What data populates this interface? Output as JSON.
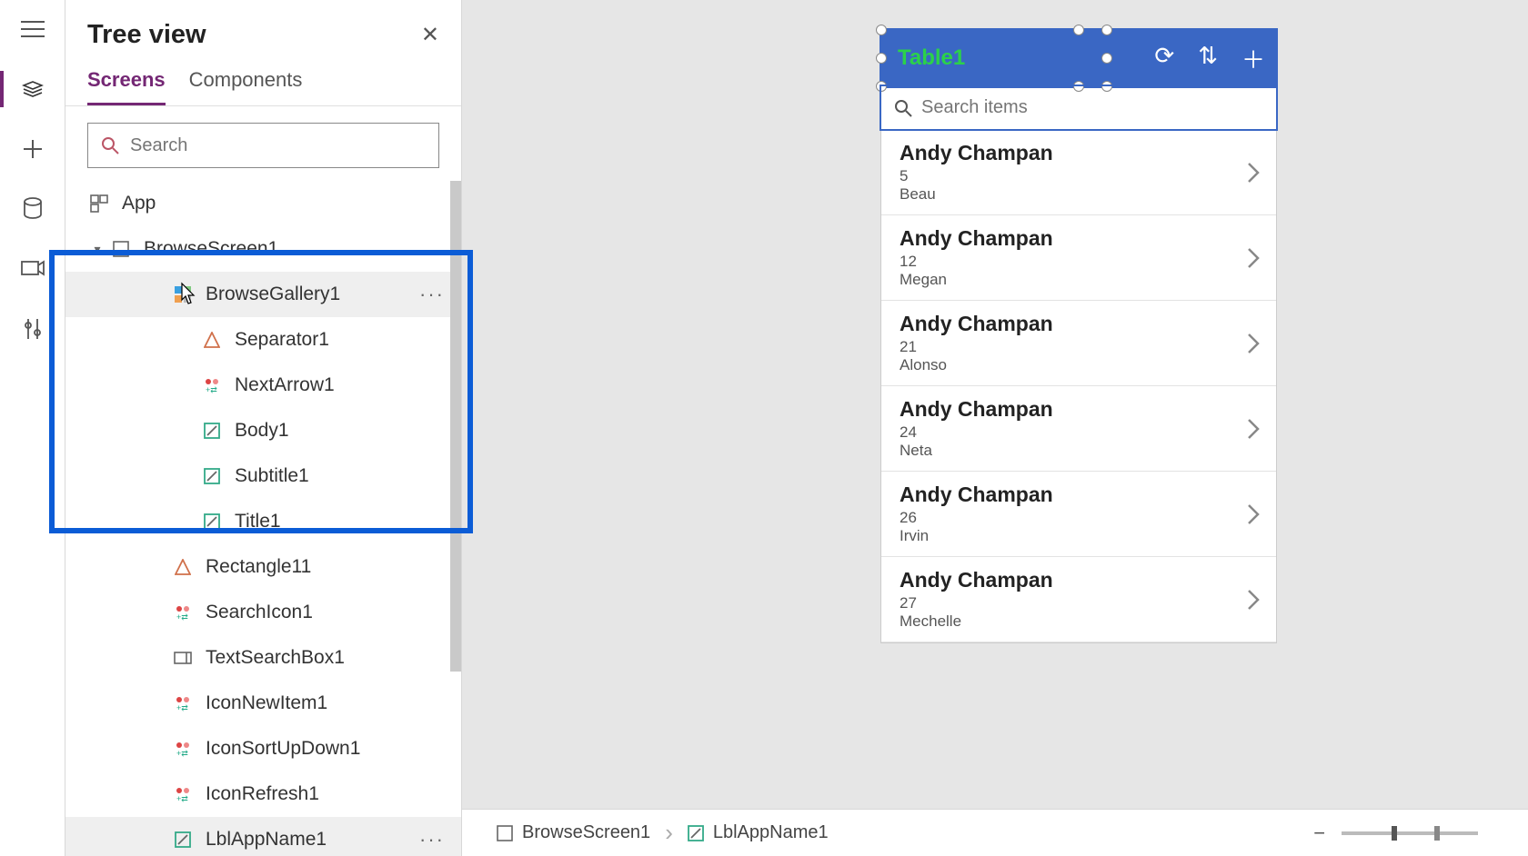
{
  "panel": {
    "title": "Tree view",
    "tabs": {
      "screens": "Screens",
      "components": "Components"
    },
    "search_placeholder": "Search"
  },
  "tree": {
    "app": "App",
    "screen": "BrowseScreen1",
    "gallery": "BrowseGallery1",
    "children": {
      "separator": "Separator1",
      "nextarrow": "NextArrow1",
      "body": "Body1",
      "subtitle": "Subtitle1",
      "title": "Title1"
    },
    "rect": "Rectangle11",
    "searchicon": "SearchIcon1",
    "textsearch": "TextSearchBox1",
    "iconnew": "IconNewItem1",
    "iconsort": "IconSortUpDown1",
    "iconrefresh": "IconRefresh1",
    "lblapp": "LblAppName1"
  },
  "preview": {
    "header_title": "Table1",
    "search_placeholder": "Search items",
    "items": [
      {
        "title": "Andy Champan",
        "num": "5",
        "sub": "Beau"
      },
      {
        "title": "Andy Champan",
        "num": "12",
        "sub": "Megan"
      },
      {
        "title": "Andy Champan",
        "num": "21",
        "sub": "Alonso"
      },
      {
        "title": "Andy Champan",
        "num": "24",
        "sub": "Neta"
      },
      {
        "title": "Andy Champan",
        "num": "26",
        "sub": "Irvin"
      },
      {
        "title": "Andy Champan",
        "num": "27",
        "sub": "Mechelle"
      }
    ]
  },
  "breadcrumb": {
    "a": "BrowseScreen1",
    "b": "LblAppName1"
  },
  "colors": {
    "accent": "#742774",
    "highlight": "#0b5cd6",
    "header": "#3a67c4",
    "title_green": "#2bd14a"
  }
}
